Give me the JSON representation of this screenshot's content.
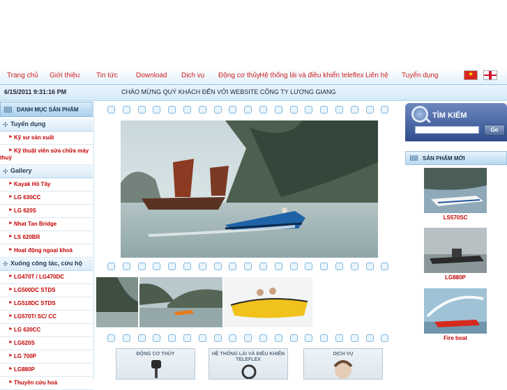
{
  "nav": {
    "items": [
      "Trang chủ",
      "Giới thiệu",
      "Tin tức",
      "Download",
      "Dịch vụ",
      "Động cơ thủy",
      "Hệ thống lái và điều khiển teleflex",
      "Liên hệ",
      "Tuyển dụng"
    ]
  },
  "status": {
    "datetime": "6/15/2011 9:31:16 PM",
    "welcome": "CHÀO MỪNG QUÝ KHÁCH ĐẾN VỚI WEBSITE CÔNG TY LƯƠNG GIANG"
  },
  "sidebar": {
    "title": "DANH MỤC SẢN PHẨM",
    "sections": [
      {
        "label": "Tuyển dụng",
        "items": [
          "Kỹ sư sản xuất",
          "Kỹ thuật viên sửa chữa máy thuỷ"
        ]
      },
      {
        "label": "Gallery",
        "items": [
          "Kayak Hồ Tây",
          "LG 630CC",
          "LG 620S",
          "Nhat Tan Bridge",
          "LS 620BR",
          "Hoạt động ngoại khoá"
        ]
      },
      {
        "label": "Xuống công tác, cứu hộ",
        "items": [
          "LG470T / LG470DC",
          "LG500DC STDS",
          "LG518DC STDS",
          "LG570T/ SC/ CC",
          "LG 630CC",
          "LG620S",
          "LG 700P",
          "LG880P",
          "Thuyền cứu hoả"
        ]
      }
    ]
  },
  "center": {
    "tiles": [
      "ĐỘNG CƠ THỦY",
      "HỆ THỐNG LÁI VÀ ĐIỀU KHIỂN TELEFLEX",
      "DỊCH VỤ"
    ]
  },
  "search": {
    "title": "TÌM KIẾM",
    "button": "Go",
    "placeholder": ""
  },
  "new_products": {
    "title": "SẢN PHẨM MỚI",
    "items": [
      "LS570SC",
      "LG880P",
      "Fire boat"
    ]
  },
  "colors": {
    "accent_red": "#c40000",
    "nav_red": "#d21f1f",
    "header_blue": "#a9d0ee",
    "search_blue": "#2f4d8d"
  }
}
